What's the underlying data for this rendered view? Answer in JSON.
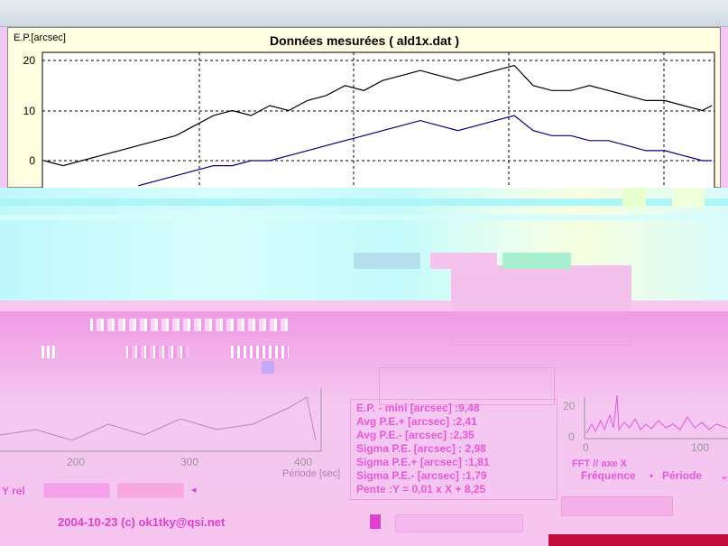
{
  "chart": {
    "title": "Données mesurées ( ald1x.dat )",
    "ylabel": "E.P.[arcsec]",
    "yticks": [
      "20",
      "10",
      "0"
    ]
  },
  "chart_data": {
    "type": "line",
    "title": "Données mesurées ( ald1x.dat )",
    "ylabel": "E.P.[arcsec]",
    "ylim": [
      -5,
      22
    ],
    "grid": true,
    "series": [
      {
        "color": "#000000",
        "x": [
          0,
          20,
          40,
          60,
          80,
          100,
          120,
          140,
          160,
          180,
          200,
          220,
          240,
          260,
          280,
          300,
          320,
          340,
          360,
          380,
          400,
          420,
          440,
          460,
          480,
          500,
          520,
          540,
          560,
          580,
          600,
          620,
          640,
          660,
          680,
          700,
          710
        ],
        "values": [
          0,
          -1,
          0,
          1,
          2,
          3,
          4,
          5,
          7,
          9,
          10,
          9,
          11,
          10,
          12,
          13,
          15,
          14,
          16,
          17,
          18,
          17,
          16,
          17,
          18,
          19,
          15,
          14,
          14,
          15,
          14,
          13,
          12,
          12,
          11,
          10,
          11
        ]
      },
      {
        "color": "#000080",
        "x": [
          100,
          120,
          140,
          160,
          180,
          200,
          220,
          240,
          260,
          280,
          300,
          320,
          340,
          360,
          380,
          400,
          420,
          440,
          460,
          480,
          500,
          520,
          540,
          560,
          580,
          600,
          620,
          640,
          660,
          680,
          700,
          710
        ],
        "values": [
          -5,
          -4,
          -3,
          -2,
          -1,
          -1,
          0,
          0,
          1,
          2,
          3,
          4,
          5,
          6,
          7,
          8,
          7,
          6,
          7,
          8,
          9,
          6,
          5,
          5,
          4,
          4,
          3,
          2,
          2,
          1,
          0,
          0
        ]
      }
    ]
  },
  "lower_chart": {
    "xticks": [
      "200",
      "300",
      "400"
    ],
    "xlabel": "Période [sec]"
  },
  "lower_chart_data": {
    "type": "line",
    "x": [
      0,
      40,
      80,
      120,
      160,
      200,
      240,
      280,
      320,
      340,
      350
    ],
    "values": [
      3,
      4,
      2,
      5,
      3,
      6,
      4,
      5,
      8,
      10,
      2
    ]
  },
  "stats": {
    "ep_min": "E.P. - mini [arcsec] :9,48",
    "avg_pos": "Avg P.E.+ [arcsec] :2,41",
    "avg_neg": "Avg P.E.- [arcsec] :2,35",
    "sigma": "Sigma P.E. [arcsec] : 2,98",
    "sigma_pos": "Sigma P.E.+ [arcsec] :1,81",
    "sigma_neg": "Sigma P.E.- [arcsec] :1,79",
    "pente": "Pente :Y = 0,01 x X + 8,25"
  },
  "fft": {
    "yticks": [
      "20",
      "0"
    ],
    "xticks": [
      "0",
      "100"
    ],
    "axis_label": "FFT // axe X",
    "freq": "Fréquence",
    "period": "Période"
  },
  "bottom": {
    "copyright": "2004-10-23 (c) ok1tky@qsi.net",
    "y_rel": "Y rel"
  },
  "colors": {
    "pink_text": "#e858d8",
    "dark_bar": "#bf0b3e"
  }
}
